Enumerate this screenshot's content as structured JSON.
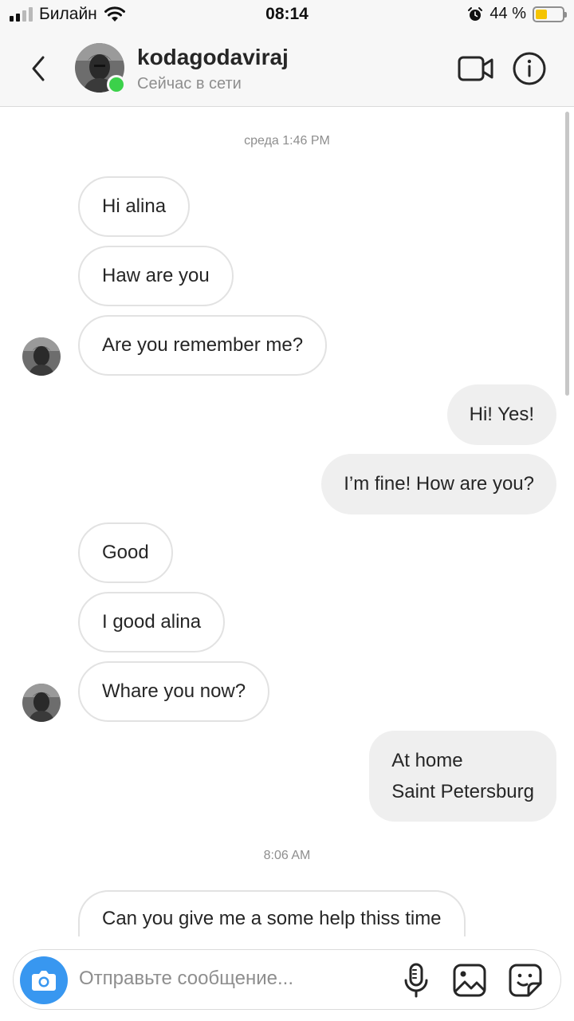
{
  "status_bar": {
    "carrier": "Билайн",
    "time": "08:14",
    "battery": "44 %",
    "battery_level": 0.44,
    "icons": [
      "signal-icon",
      "wifi-icon",
      "alarm-icon",
      "battery-icon"
    ]
  },
  "header": {
    "username": "kodagodaviraj",
    "status": "Сейчас в сети",
    "online_color": "#3bd14a",
    "icons": [
      "back-chevron-icon",
      "video-camera-icon",
      "info-icon"
    ]
  },
  "chat": {
    "timestamp_1": "среда 1:46 PM",
    "timestamp_2": "8:06 AM",
    "messages": [
      {
        "from": "them",
        "text": "Hi alina"
      },
      {
        "from": "them",
        "text": "Haw are you"
      },
      {
        "from": "them",
        "text": "Are you remember me?"
      },
      {
        "from": "me",
        "text": "Hi! Yes!"
      },
      {
        "from": "me",
        "text": "I’m fine! How are you?"
      },
      {
        "from": "them",
        "text": "Good"
      },
      {
        "from": "them",
        "text": "I good alina"
      },
      {
        "from": "them",
        "text": "Whare you now?"
      },
      {
        "from": "me",
        "lines": [
          "At home",
          "Saint Petersburg"
        ]
      },
      {
        "from": "them",
        "text": "Can you give me a some help thiss time"
      }
    ]
  },
  "composer": {
    "placeholder": "Отправьте сообщение...",
    "accent": "#3897f0",
    "icons": [
      "camera-icon",
      "microphone-icon",
      "gallery-icon",
      "sticker-icon"
    ]
  }
}
